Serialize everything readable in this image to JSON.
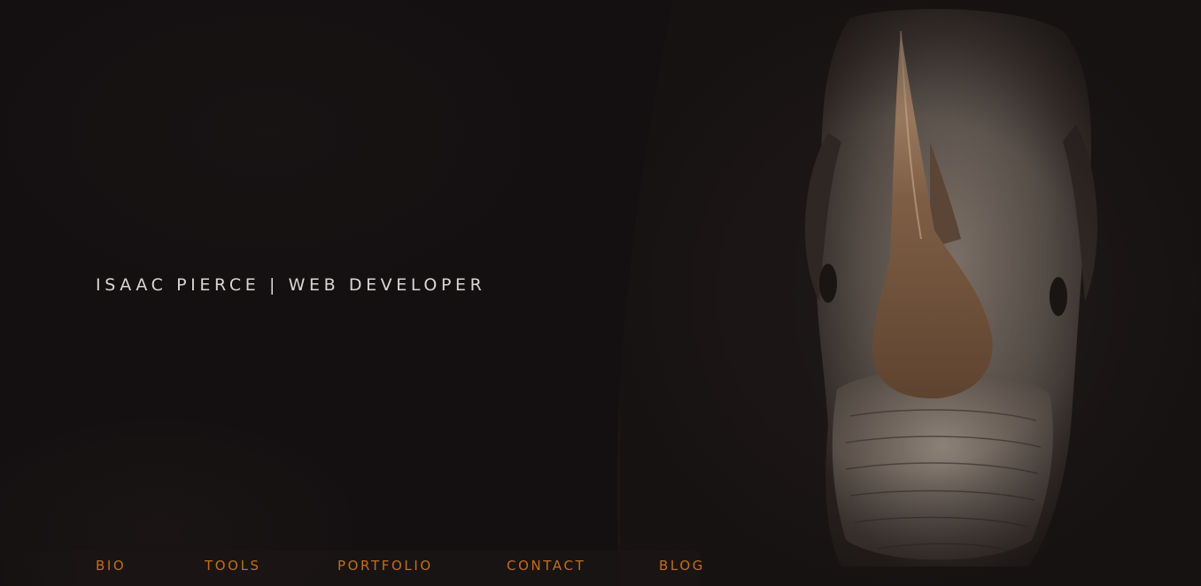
{
  "hero": {
    "title": "ISAAC PIERCE | WEB DEVELOPER",
    "image": "rhino-portrait"
  },
  "nav": {
    "items": [
      {
        "label": "BIO"
      },
      {
        "label": "TOOLS"
      },
      {
        "label": "PORTFOLIO"
      },
      {
        "label": "CONTACT"
      },
      {
        "label": "BLOG"
      }
    ]
  },
  "colors": {
    "background": "#141011",
    "title": "#d9d6d2",
    "accent": "#c26e1c"
  }
}
